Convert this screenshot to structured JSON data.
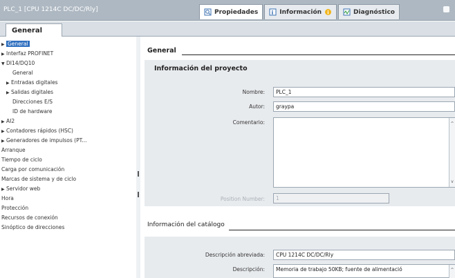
{
  "header": {
    "title": "PLC_1 [CPU 1214C DC/DC/Rly]",
    "tabs": [
      {
        "label": "Propiedades",
        "icon": "properties-icon",
        "active": true
      },
      {
        "label": "Información",
        "icon": "info-icon",
        "active": false
      },
      {
        "label": "Diagnóstico",
        "icon": "diagnostics-icon",
        "active": false
      }
    ]
  },
  "general_tab": "General",
  "sidebar": {
    "items": [
      {
        "label": "General",
        "arrow": "▶"
      },
      {
        "label": "Interfaz PROFINET",
        "arrow": "▶"
      },
      {
        "label": "DI14/DQ10",
        "arrow": "▼"
      },
      {
        "label": "General",
        "arrow": ""
      },
      {
        "label": "Entradas digitales",
        "arrow": "▶"
      },
      {
        "label": "Salidas digitales",
        "arrow": "▶"
      },
      {
        "label": "Direcciones E/S",
        "arrow": ""
      },
      {
        "label": "ID de hardware",
        "arrow": ""
      },
      {
        "label": "AI2",
        "arrow": "▶"
      },
      {
        "label": "Contadores rápidos (HSC)",
        "arrow": "▶"
      },
      {
        "label": "Generadores de impulsos (PT...",
        "arrow": "▶"
      },
      {
        "label": "Arranque",
        "arrow": ""
      },
      {
        "label": "Tiempo de ciclo",
        "arrow": ""
      },
      {
        "label": "Carga por comunicación",
        "arrow": ""
      },
      {
        "label": "Marcas de sistema y de ciclo",
        "arrow": ""
      },
      {
        "label": "Servidor web",
        "arrow": "▶"
      },
      {
        "label": "Hora",
        "arrow": ""
      },
      {
        "label": "Protección",
        "arrow": ""
      },
      {
        "label": "Recursos de conexión",
        "arrow": ""
      },
      {
        "label": "Sinóptico de direcciones",
        "arrow": ""
      }
    ]
  },
  "main": {
    "general_section": "General",
    "project_info": {
      "title": "Información del proyecto",
      "name_label": "Nombre:",
      "name_value": "PLC_1",
      "author_label": "Autor:",
      "author_value": "graypa",
      "comment_label": "Comentario:",
      "comment_value": "",
      "position_label": "Position Number:",
      "position_value": "1"
    },
    "catalog_section": "Información del catálogo",
    "catalog": {
      "short_desc_label": "Descripción abreviada:",
      "short_desc_value": "CPU 1214C DC/DC/Rly",
      "desc_label": "Descripción:",
      "desc_value": "Memoria de trabajo 50KB; fuente de alimentació"
    }
  }
}
